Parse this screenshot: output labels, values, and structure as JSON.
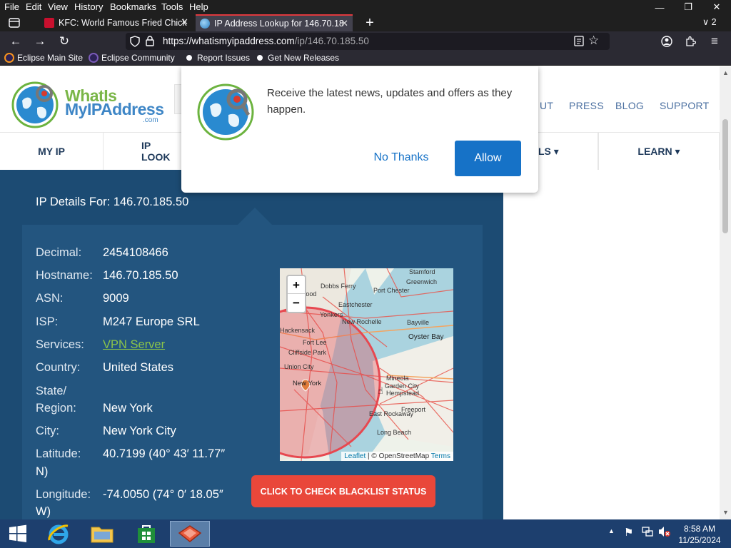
{
  "menubar": {
    "items": [
      "File",
      "Edit",
      "View",
      "History",
      "Bookmarks",
      "Tools",
      "Help"
    ],
    "accelerators": [
      "F",
      "E",
      "V",
      "s",
      "B",
      "T",
      "H"
    ]
  },
  "window_controls": {
    "minimize": "—",
    "restore": "❐",
    "close": "✕"
  },
  "tabs": [
    {
      "title": "KFC: World Famous Fried Chick",
      "active": false
    },
    {
      "title": "IP Address Lookup for 146.70.18",
      "active": true
    }
  ],
  "tab_overflow": {
    "count": "2"
  },
  "address_bar": {
    "url_host": "https://whatismyipaddress.com",
    "url_path": "/ip/146.70.185.50"
  },
  "bookmarks": [
    "Eclipse Main Site",
    "Eclipse Community",
    "Report Issues",
    "Get New Releases"
  ],
  "site": {
    "logo_line1": "WhatIs",
    "logo_line2": "MyIPAddress",
    "logo_suffix": ".com",
    "top_links": [
      "UT",
      "PRESS",
      "BLOG",
      "SUPPORT"
    ],
    "nav": [
      {
        "label": "MY IP"
      },
      {
        "label": "IP LOOK"
      },
      {
        "label": "LS ▾"
      },
      {
        "label": "LEARN ▾"
      }
    ]
  },
  "ip_details": {
    "title": "IP Details For: 146.70.185.50",
    "rows": [
      {
        "label": "Decimal:",
        "value": "2454108466"
      },
      {
        "label": "Hostname:",
        "value": "146.70.185.50"
      },
      {
        "label": "ASN:",
        "value": "9009"
      },
      {
        "label": "ISP:",
        "value": "M247 Europe SRL"
      },
      {
        "label": "Services:",
        "value": "VPN Server"
      },
      {
        "label": "Country:",
        "value": "United States"
      },
      {
        "label": "State/",
        "label2": "Region:",
        "value": "New York"
      },
      {
        "label": "City:",
        "value": "New York City"
      },
      {
        "label": "Latitude:",
        "value": "40.7199 (40° 43′ 11.77″",
        "value2": "N)"
      },
      {
        "label": "Longitude:",
        "value": "-74.0050 (74° 0′ 18.05″",
        "value2": "W)"
      }
    ]
  },
  "map": {
    "zoom_in": "+",
    "zoom_out": "−",
    "places": [
      "Stamford",
      "Greenwich",
      "Dobbs Ferry",
      "Port Chester",
      "Eastchester",
      "Yonkers",
      "New Rochelle",
      "Bayville",
      "Oyster Bay",
      "Hackensack",
      "Fort Lee",
      "Cliffside Park",
      "Union City",
      "New York",
      "Mineola",
      "Garden City",
      "Hempstead",
      "Freeport",
      "East Rockaway",
      "Long Beach",
      "Wood"
    ],
    "attribution_leaflet": "Leaflet",
    "attribution_sep": " | © OpenStreetMap ",
    "attribution_terms": "Terms"
  },
  "blacklist_button": "CLICK TO CHECK BLACKLIST STATUS",
  "popup": {
    "message": "Receive the latest news, updates and offers as they happen.",
    "no_thanks": "No Thanks",
    "allow": "Allow"
  },
  "taskbar": {
    "time": "8:58 AM",
    "date": "11/25/2024"
  },
  "colors": {
    "page_blue": "#1c4b73",
    "panel_blue": "#23557f",
    "allow_blue": "#1672c7",
    "blacklist_red": "#e9473a",
    "vpn_link_green": "#8bc34a"
  }
}
